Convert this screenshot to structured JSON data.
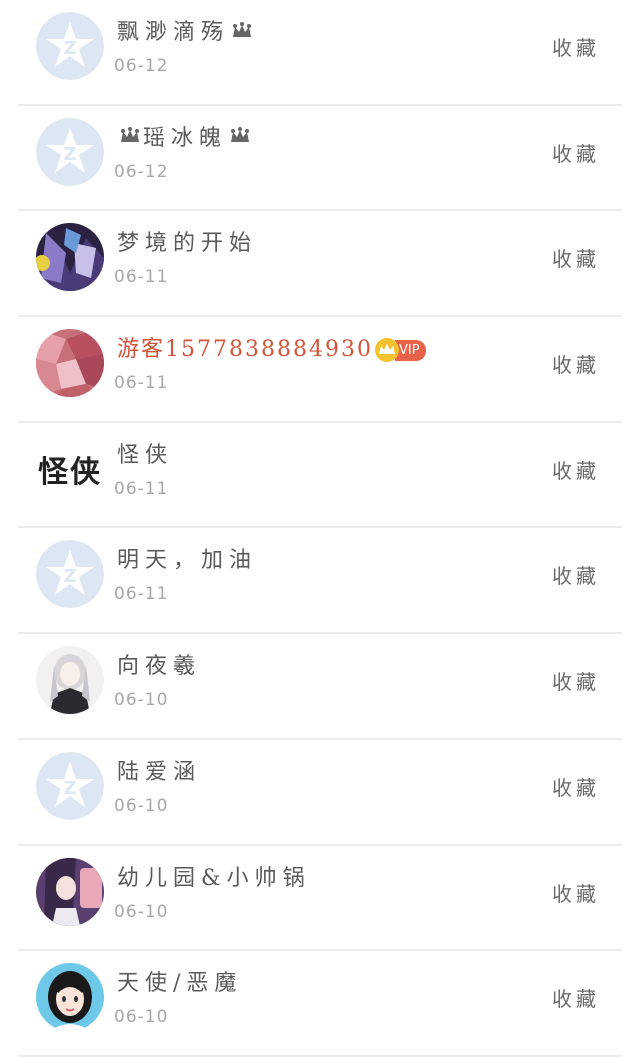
{
  "items": [
    {
      "name": "飘渺滴殇",
      "date": "06-12",
      "action": "收藏",
      "avatar": "default-qq"
    },
    {
      "name": "瑶冰魄",
      "date": "06-12",
      "action": "收藏",
      "avatar": "default-qq"
    },
    {
      "name": "梦境的开始",
      "date": "06-11",
      "action": "收藏",
      "avatar": "anime-dark"
    },
    {
      "name": "游客1577838884930",
      "date": "06-11",
      "action": "收藏",
      "avatar": "pink-gems",
      "vip": "VIP"
    },
    {
      "name": "怪侠",
      "date": "06-11",
      "action": "收藏",
      "avatar": "calligraphy",
      "avatar_text": "怪侠"
    },
    {
      "name": "明天，加油",
      "date": "06-11",
      "action": "收藏",
      "avatar": "default-qq"
    },
    {
      "name": "向夜羲",
      "date": "06-10",
      "action": "收藏",
      "avatar": "anime-girl"
    },
    {
      "name": "陆爱涵",
      "date": "06-10",
      "action": "收藏",
      "avatar": "default-qq"
    },
    {
      "name": "幼儿园&小帅锅",
      "date": "06-10",
      "action": "收藏",
      "avatar": "anime-purple"
    },
    {
      "name": "天使/恶魔",
      "date": "06-10",
      "action": "收藏",
      "avatar": "cartoon-girl"
    }
  ],
  "colors": {
    "vip_name": "#d0553a",
    "vip_badge": "#e8624a",
    "divider": "#ececec"
  }
}
